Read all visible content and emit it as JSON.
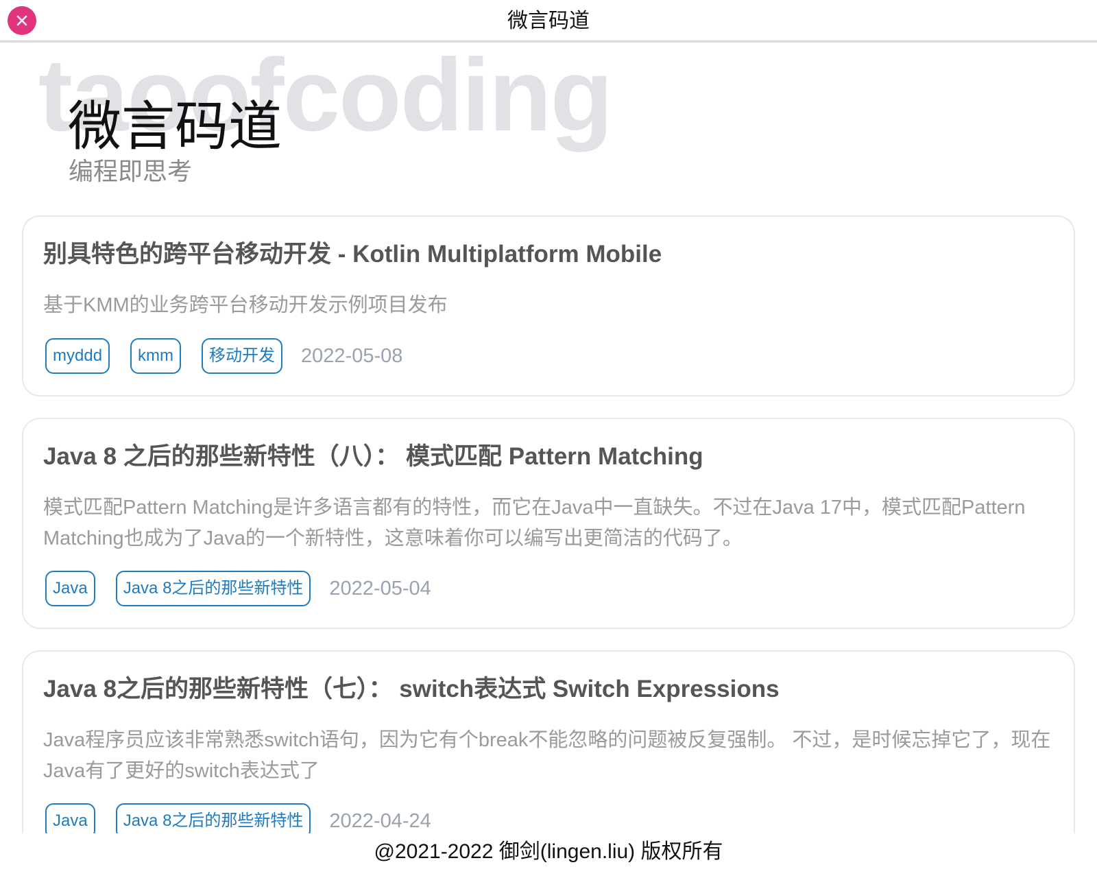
{
  "window": {
    "title": "微言码道"
  },
  "hero": {
    "watermark": "taoofcoding",
    "title": "微言码道",
    "subtitle": "编程即思考"
  },
  "posts": [
    {
      "title": "别具特色的跨平台移动开发 - Kotlin Multiplatform Mobile",
      "summary": "基于KMM的业务跨平台移动开发示例项目发布",
      "tags": [
        "myddd",
        "kmm",
        "移动开发"
      ],
      "date": "2022-05-08"
    },
    {
      "title": "Java 8 之后的那些新特性（八）： 模式匹配 Pattern Matching",
      "summary": "模式匹配Pattern Matching是许多语言都有的特性，而它在Java中一直缺失。不过在Java 17中，模式匹配Pattern Matching也成为了Java的一个新特性，这意味着你可以编写出更简洁的代码了。",
      "tags": [
        "Java",
        "Java 8之后的那些新特性"
      ],
      "date": "2022-05-04"
    },
    {
      "title": "Java 8之后的那些新特性（七）： switch表达式 Switch Expressions",
      "summary": "Java程序员应该非常熟悉switch语句，因为它有个break不能忽略的问题被反复强制。 不过，是时候忘掉它了，现在Java有了更好的switch表达式了",
      "tags": [
        "Java",
        "Java 8之后的那些新特性"
      ],
      "date": "2022-04-24"
    }
  ],
  "footer": {
    "copyright": "@2021-2022 御剑(lingen.liu) 版权所有"
  },
  "colors": {
    "close": "#e0357d",
    "tag": "#1f7bbf",
    "date": "#9aa2ad"
  },
  "icons": {
    "close": "close-icon"
  }
}
